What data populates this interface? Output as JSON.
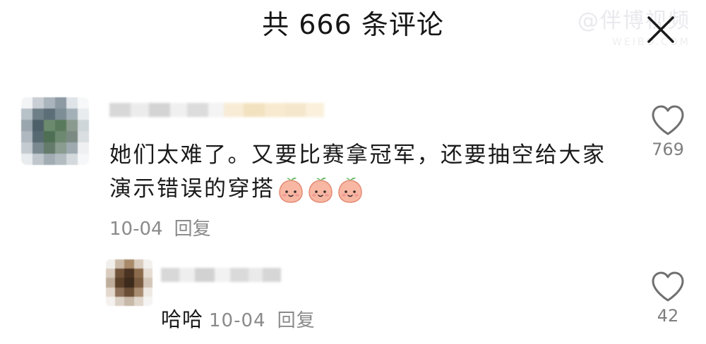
{
  "header": {
    "title": "共 666 条评论",
    "watermark": "@伴博视频",
    "watermark_sub": "WEIBO.COM"
  },
  "comments": [
    {
      "text": "她们太难了。又要比赛拿冠军，还要抽空给大家演示错误的穿搭",
      "emoji": [
        "peach-face-emoji",
        "peach-face-emoji",
        "peach-face-emoji"
      ],
      "date": "10-04",
      "reply_label": "回复",
      "likes": "769"
    }
  ],
  "replies": [
    {
      "text": "哈哈",
      "date": "10-04",
      "reply_label": "回复",
      "likes": "42"
    }
  ],
  "icons": {
    "close": "close-icon",
    "like": "heart-outline-icon"
  },
  "colors": {
    "text_primary": "#1a1a1a",
    "text_secondary": "#8a8a8a",
    "emoji_body": "#f7b7a3",
    "emoji_leaf": "#5cb85c"
  }
}
